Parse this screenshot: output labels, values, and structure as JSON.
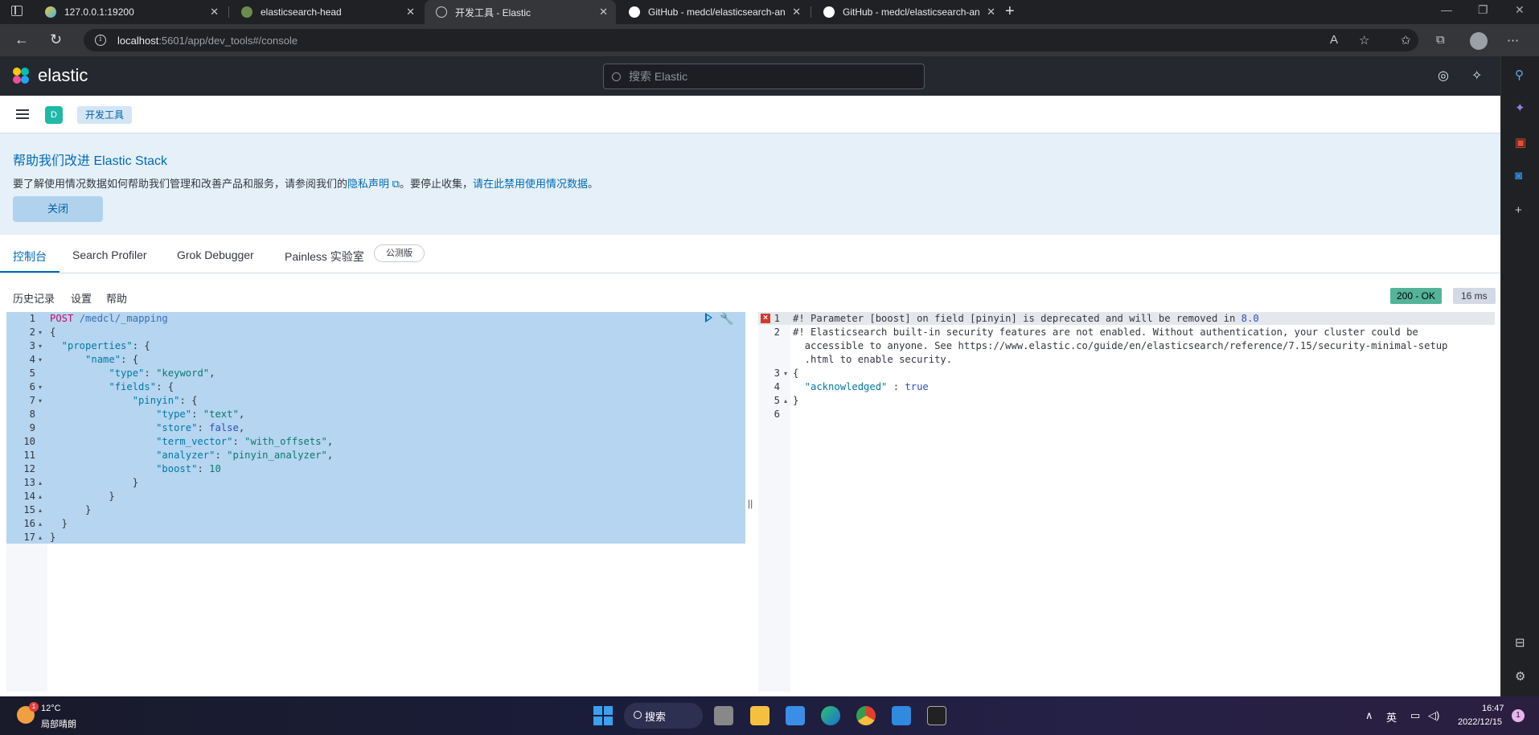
{
  "browser": {
    "tabs": [
      {
        "title": "127.0.0.1:19200",
        "active": false
      },
      {
        "title": "elasticsearch-head",
        "active": false
      },
      {
        "title": "开发工具 - Elastic",
        "active": true
      },
      {
        "title": "GitHub - medcl/elasticsearch-ana…",
        "active": false
      },
      {
        "title": "GitHub - medcl/elasticsearch-ana…",
        "active": false
      }
    ],
    "url_host": "localhost",
    "url_rest": ":5601/app/dev_tools#/console"
  },
  "kibana": {
    "brand": "elastic",
    "search_placeholder": "搜索 Elastic",
    "space_initial": "D",
    "breadcrumb": "开发工具"
  },
  "callout": {
    "title": "帮助我们改进 Elastic Stack",
    "text_before": "要了解使用情况数据如何帮助我们管理和改善产品和服务，请参阅我们的",
    "privacy_link": "隐私声明",
    "text_middle": "。要停止收集，",
    "disable_link": "请在此禁用使用情况数据",
    "text_after": "。",
    "close_label": "关闭"
  },
  "devtools": {
    "tabs": [
      "控制台",
      "Search Profiler",
      "Grok Debugger",
      "Painless 实验室"
    ],
    "beta_badge": "公测版",
    "console_nav": [
      "历史记录",
      "设置",
      "帮助"
    ],
    "status": "200 - OK",
    "time": "16 ms"
  },
  "request_lines": [
    {
      "n": "1",
      "fold": "",
      "parts": [
        {
          "t": "POST",
          "c": "method"
        },
        {
          "t": " /medcl/_mapping",
          "c": "path"
        }
      ]
    },
    {
      "n": "2",
      "fold": "▾",
      "parts": [
        {
          "t": "{",
          "c": "punct"
        }
      ]
    },
    {
      "n": "3",
      "fold": "▾",
      "parts": [
        {
          "t": "  \"properties\"",
          "c": "key"
        },
        {
          "t": ": {",
          "c": "punct"
        }
      ]
    },
    {
      "n": "4",
      "fold": "▾",
      "parts": [
        {
          "t": "      \"name\"",
          "c": "key"
        },
        {
          "t": ": {",
          "c": "punct"
        }
      ]
    },
    {
      "n": "5",
      "fold": "",
      "parts": [
        {
          "t": "          \"type\"",
          "c": "key"
        },
        {
          "t": ": ",
          "c": "punct"
        },
        {
          "t": "\"keyword\"",
          "c": "str"
        },
        {
          "t": ",",
          "c": "punct"
        }
      ]
    },
    {
      "n": "6",
      "fold": "▾",
      "parts": [
        {
          "t": "          \"fields\"",
          "c": "key"
        },
        {
          "t": ": {",
          "c": "punct"
        }
      ]
    },
    {
      "n": "7",
      "fold": "▾",
      "parts": [
        {
          "t": "              \"pinyin\"",
          "c": "key"
        },
        {
          "t": ": {",
          "c": "punct"
        }
      ]
    },
    {
      "n": "8",
      "fold": "",
      "parts": [
        {
          "t": "                  \"type\"",
          "c": "key"
        },
        {
          "t": ": ",
          "c": "punct"
        },
        {
          "t": "\"text\"",
          "c": "str"
        },
        {
          "t": ",",
          "c": "punct"
        }
      ]
    },
    {
      "n": "9",
      "fold": "",
      "parts": [
        {
          "t": "                  \"store\"",
          "c": "key"
        },
        {
          "t": ": ",
          "c": "punct"
        },
        {
          "t": "false",
          "c": "bool"
        },
        {
          "t": ",",
          "c": "punct"
        }
      ]
    },
    {
      "n": "10",
      "fold": "",
      "parts": [
        {
          "t": "                  \"term_vector\"",
          "c": "key"
        },
        {
          "t": ": ",
          "c": "punct"
        },
        {
          "t": "\"with_offsets\"",
          "c": "str"
        },
        {
          "t": ",",
          "c": "punct"
        }
      ]
    },
    {
      "n": "11",
      "fold": "",
      "parts": [
        {
          "t": "                  \"analyzer\"",
          "c": "key"
        },
        {
          "t": ": ",
          "c": "punct"
        },
        {
          "t": "\"pinyin_analyzer\"",
          "c": "str"
        },
        {
          "t": ",",
          "c": "punct"
        }
      ]
    },
    {
      "n": "12",
      "fold": "",
      "parts": [
        {
          "t": "                  \"boost\"",
          "c": "key"
        },
        {
          "t": ": ",
          "c": "punct"
        },
        {
          "t": "10",
          "c": "num"
        }
      ]
    },
    {
      "n": "13",
      "fold": "▴",
      "parts": [
        {
          "t": "              }",
          "c": "punct"
        }
      ]
    },
    {
      "n": "14",
      "fold": "▴",
      "parts": [
        {
          "t": "          }",
          "c": "punct"
        }
      ]
    },
    {
      "n": "15",
      "fold": "▴",
      "parts": [
        {
          "t": "      }",
          "c": "punct"
        }
      ]
    },
    {
      "n": "16",
      "fold": "▴",
      "parts": [
        {
          "t": "  }",
          "c": "punct"
        }
      ]
    },
    {
      "n": "17",
      "fold": "▴",
      "parts": [
        {
          "t": "}",
          "c": "punct"
        }
      ]
    }
  ],
  "response_lines": [
    {
      "n": "1",
      "fold": "",
      "parts": [
        {
          "t": "#! Parameter [boost] on field [pinyin] is deprecated and will be removed in ",
          "c": "comment"
        },
        {
          "t": "8.0",
          "c": "bool"
        }
      ]
    },
    {
      "n": "2",
      "fold": "",
      "parts": [
        {
          "t": "#! Elasticsearch built-in security features are not enabled. Without authentication, your cluster could be",
          "c": "comment"
        }
      ]
    },
    {
      "n": "",
      "fold": "",
      "parts": [
        {
          "t": "  accessible to anyone. See https://www.elastic.co/guide/en/elasticsearch/reference/7.15/security-minimal-setup",
          "c": "comment"
        }
      ]
    },
    {
      "n": "",
      "fold": "",
      "parts": [
        {
          "t": "  .html to enable security.",
          "c": "comment"
        }
      ]
    },
    {
      "n": "3",
      "fold": "▾",
      "parts": [
        {
          "t": "{",
          "c": "punct"
        }
      ]
    },
    {
      "n": "4",
      "fold": "",
      "parts": [
        {
          "t": "  \"acknowledged\"",
          "c": "key"
        },
        {
          "t": " : ",
          "c": "punct"
        },
        {
          "t": "true",
          "c": "bool"
        }
      ]
    },
    {
      "n": "5",
      "fold": "▴",
      "parts": [
        {
          "t": "}",
          "c": "punct"
        }
      ]
    },
    {
      "n": "6",
      "fold": "",
      "parts": []
    }
  ],
  "taskbar": {
    "temperature": "12°C",
    "weather": "局部晴朗",
    "weather_badge": "1",
    "search_label": "搜索",
    "ime": "英",
    "time": "16:47",
    "date": "2022/12/15",
    "notifications": "1"
  }
}
